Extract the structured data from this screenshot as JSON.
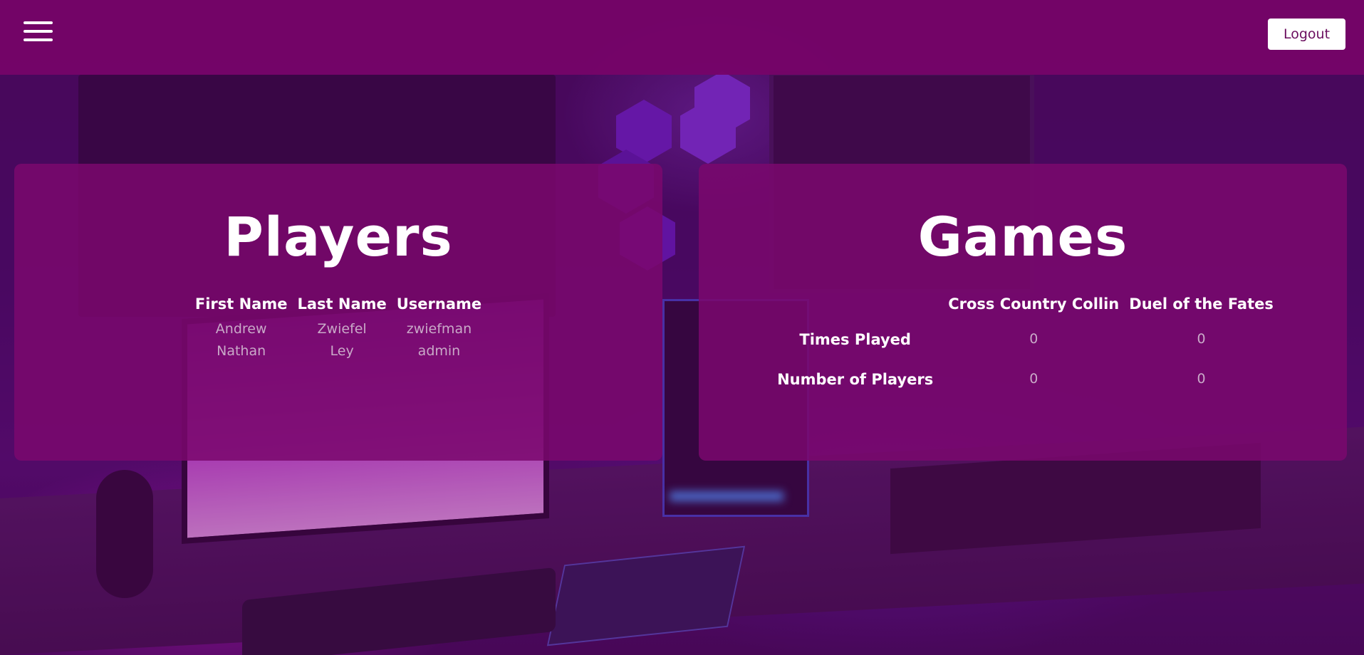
{
  "header": {
    "menu_icon": "hamburger-menu-icon",
    "logout_label": "Logout"
  },
  "players": {
    "title": "Players",
    "columns": [
      "First Name",
      "Last Name",
      "Username"
    ],
    "rows": [
      [
        "Andrew",
        "Zwiefel",
        "zwiefman"
      ],
      [
        "Nathan",
        "Ley",
        "admin"
      ]
    ]
  },
  "games": {
    "title": "Games",
    "columns": [
      "Cross Country Collin",
      "Duel of the Fates"
    ],
    "rows": [
      {
        "label": "Times Played",
        "values": [
          "0",
          "0"
        ]
      },
      {
        "label": "Number of Players",
        "values": [
          "0",
          "0"
        ]
      }
    ]
  },
  "colors": {
    "header_bg": "#760468",
    "card_bg": "#7a086e",
    "button_text": "#6a0d5e",
    "cell_text": "#c9a9c8"
  }
}
